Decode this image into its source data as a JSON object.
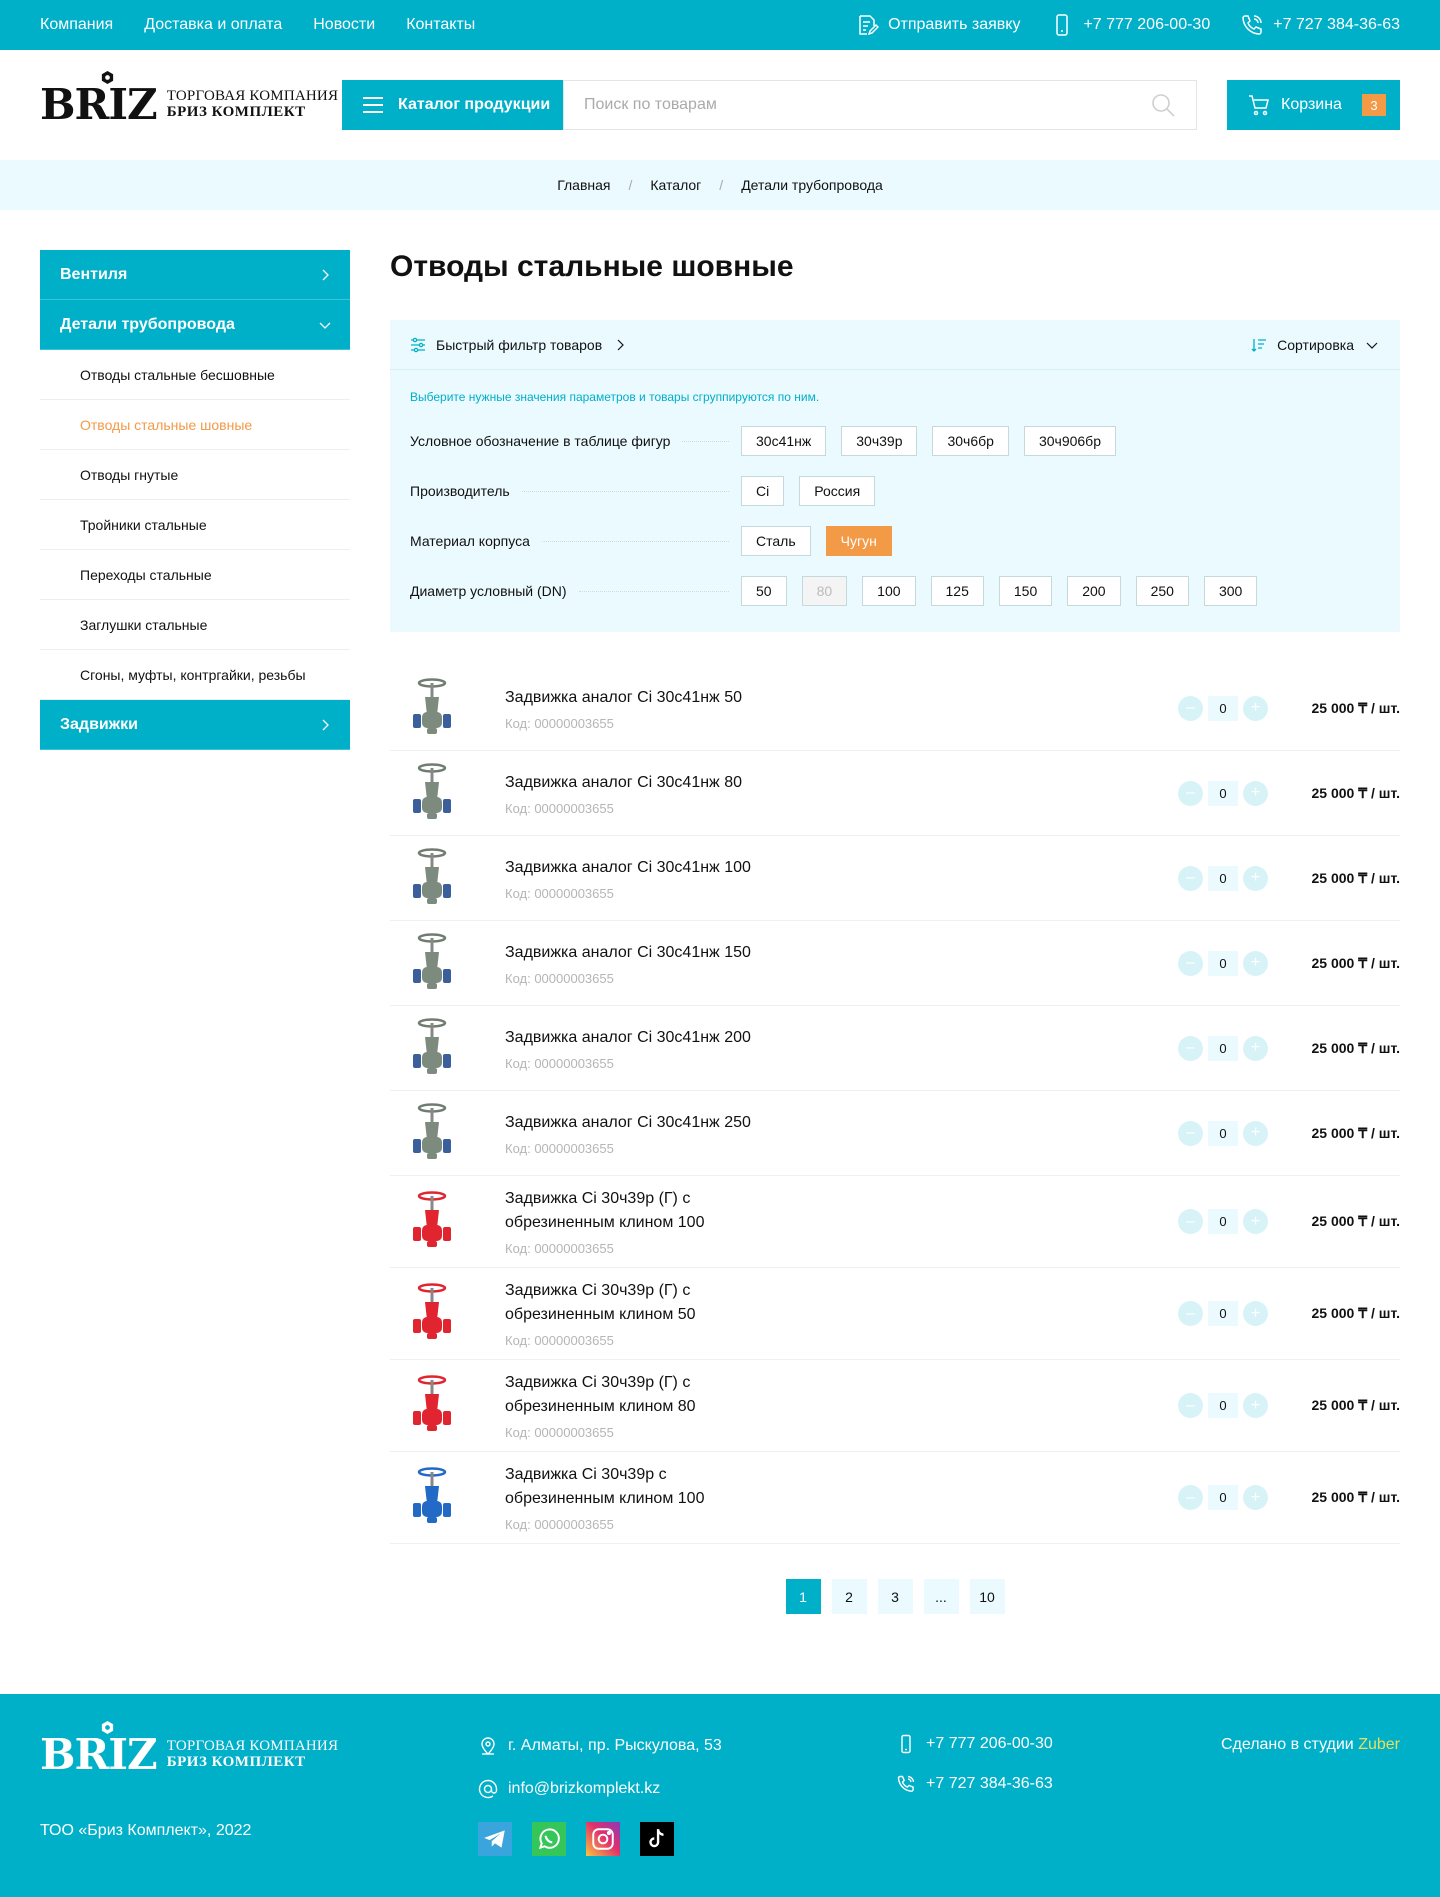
{
  "topbar": {
    "nav": [
      "Компания",
      "Доставка и оплата",
      "Новости",
      "Контакты"
    ],
    "request": "Отправить заявку",
    "phone1": "+7 777 206-00-30",
    "phone2": "+7 727 384-36-63"
  },
  "header": {
    "logo_word": "BRIZ",
    "logo_line1": "ТОРГОВАЯ КОМПАНИЯ",
    "logo_line2": "БРИЗ КОМПЛЕКТ",
    "catalog_label": "Каталог продукции",
    "search_placeholder": "Поиск по товарам",
    "cart_label": "Корзина",
    "cart_count": "3"
  },
  "breadcrumbs": [
    "Главная",
    "Каталог",
    "Детали трубопровода"
  ],
  "sidebar": {
    "group1": "Вентиля",
    "group2": "Детали трубопровода",
    "sub": [
      "Отводы стальные бесшовные",
      "Отводы стальные шовные",
      "Отводы гнутые",
      "Тройники стальные",
      "Переходы стальные",
      "Заглушки стальные",
      "Сгоны, муфты, контргайки, резьбы"
    ],
    "group3": "Задвижки"
  },
  "page_title": "Отводы стальные шовные",
  "filter": {
    "quick": "Быстрый фильтр товаров",
    "sort": "Сортировка",
    "hint": "Выберите нужные значения параметров и товары сгруппируются по ним.",
    "rows": [
      {
        "label": "Условное обозначение в таблице фигур",
        "chips": [
          "30с41нж",
          "30ч39р",
          "30ч6бр",
          "30ч906бр"
        ]
      },
      {
        "label": "Производитель",
        "chips": [
          "Ci",
          "Россия"
        ]
      },
      {
        "label": "Материал корпуса",
        "chips": [
          "Сталь",
          "Чугун"
        ]
      },
      {
        "label": "Диаметр условный (DN)",
        "chips": [
          "50",
          "80",
          "100",
          "125",
          "150",
          "200",
          "250",
          "300"
        ]
      }
    ]
  },
  "products": [
    {
      "name": "Задвижка аналог Ci 30с41нж 50",
      "code": "Код: 00000003655",
      "qty": "0",
      "price": "25 000 ₸ / шт."
    },
    {
      "name": "Задвижка аналог Ci 30с41нж 80",
      "code": "Код: 00000003655",
      "qty": "0",
      "price": "25 000 ₸ / шт."
    },
    {
      "name": "Задвижка аналог Ci 30с41нж 100",
      "code": "Код: 00000003655",
      "qty": "0",
      "price": "25 000 ₸ / шт."
    },
    {
      "name": "Задвижка аналог Ci 30с41нж 150",
      "code": "Код: 00000003655",
      "qty": "0",
      "price": "25 000 ₸ / шт."
    },
    {
      "name": "Задвижка аналог Ci 30с41нж 200",
      "code": "Код: 00000003655",
      "qty": "0",
      "price": "25 000 ₸ / шт."
    },
    {
      "name": "Задвижка аналог Ci 30с41нж 250",
      "code": "Код: 00000003655",
      "qty": "0",
      "price": "25 000 ₸ / шт."
    },
    {
      "name": "Задвижка Ci 30ч39р (Г) с обрезиненным клином 100",
      "code": "Код: 00000003655",
      "qty": "0",
      "price": "25 000 ₸ / шт."
    },
    {
      "name": "Задвижка Ci 30ч39р (Г) с обрезиненным клином 50",
      "code": "Код: 00000003655",
      "qty": "0",
      "price": "25 000 ₸ / шт."
    },
    {
      "name": "Задвижка Ci 30ч39р (Г) с обрезиненным клином 80",
      "code": "Код: 00000003655",
      "qty": "0",
      "price": "25 000 ₸ / шт."
    },
    {
      "name": "Задвижка Ci 30ч39р с обрезиненным клином 100",
      "code": "Код: 00000003655",
      "qty": "0",
      "price": "25 000 ₸ / шт."
    }
  ],
  "pagination": [
    "1",
    "2",
    "3",
    "...",
    "10"
  ],
  "footer": {
    "copyright": "ТОО «Бриз Комплект», 2022",
    "address": "г. Алматы, пр. Рыскулова, 53",
    "email": "info@brizkomplekt.kz",
    "phone1": "+7 777 206-00-30",
    "phone2": "+7 727 384-36-63",
    "made_prefix": "Сделано в студии",
    "made_studio": "Zuber"
  },
  "colors": {
    "accent": "#00afc8",
    "orange": "#f39a47",
    "light": "#eafaff"
  }
}
